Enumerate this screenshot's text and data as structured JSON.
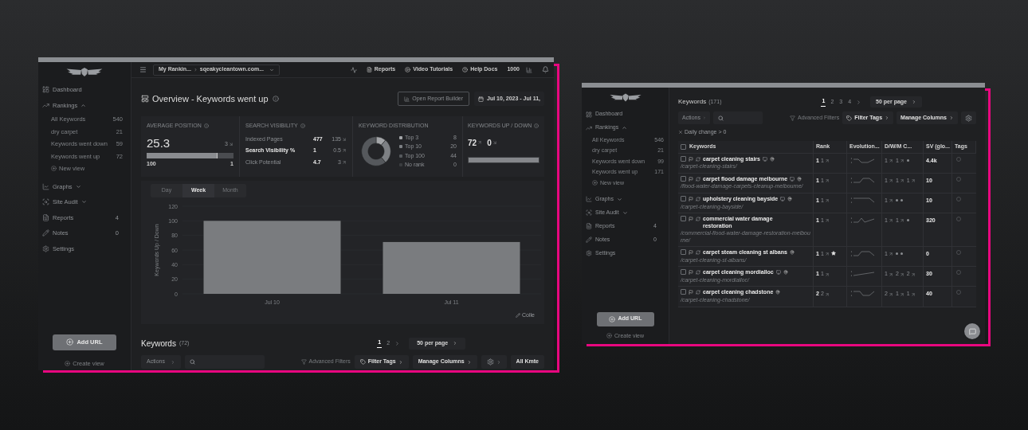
{
  "left_window": {
    "sidebar": {
      "nav": [
        {
          "label": "Dashboard"
        },
        {
          "label": "Rankings",
          "expanded": true,
          "children": [
            {
              "label": "All Keywords",
              "count": "540"
            },
            {
              "label": "dry carpet",
              "count": "21"
            },
            {
              "label": "Keywords went down",
              "count": "59"
            },
            {
              "label": "Keywords went up",
              "count": "72"
            }
          ],
          "add_label": "New view"
        },
        {
          "label": "Graphs",
          "expanded": false
        },
        {
          "label": "Site Audit",
          "expanded": false
        },
        {
          "label": "Reports",
          "count": "4"
        },
        {
          "label": "Notes",
          "count": "0"
        },
        {
          "label": "Settings"
        }
      ],
      "add_button": "Add URL",
      "create_view": "Create view"
    },
    "topbar": {
      "breadcrumb": [
        "My Rankin...",
        "sqeakycleantown.com..."
      ],
      "links": [
        "Reports",
        "Video Tutorials",
        "Help Docs"
      ],
      "credits": "1000"
    },
    "title": "Overview - Keywords went up",
    "report_button": "Open Report Builder",
    "date_range": "Jul 10, 2023 - Jul 11,",
    "average_position": {
      "title": "AVERAGE POSITION",
      "value": "25.3",
      "change": "3",
      "level": 0.82,
      "min": "100",
      "max": "1"
    },
    "search_visibility": {
      "title": "SEARCH VISIBILITY",
      "rows": [
        {
          "label": "Indexed Pages",
          "value": "477",
          "change": "135",
          "rising": false,
          "emphasis": false
        },
        {
          "label": "Search Visibility %",
          "value": "1",
          "change": "0.5",
          "rising": true,
          "emphasis": true
        },
        {
          "label": "Click Potential",
          "value": "4.7",
          "change": "3",
          "rising": true,
          "emphasis": false
        }
      ]
    },
    "keyword_distribution": {
      "title": "KEYWORD DISTRIBUTION",
      "chart_data": {
        "type": "donut",
        "categories": [
          "Top 3",
          "Top 10",
          "Top 100",
          "No rank"
        ],
        "values": [
          11.1,
          27.8,
          61.1,
          0
        ],
        "colors": [
          "#a3a5a8",
          "#7d8084",
          "#55585c",
          "#3a3c3f"
        ]
      },
      "counts": [
        "8",
        "20",
        "44",
        "0"
      ]
    },
    "keywords_up_down": {
      "title": "KEYWORDS UP / DOWN",
      "up": "72",
      "down": "0",
      "level": 1
    },
    "period_tabs": [
      {
        "label": "Day",
        "selected": false
      },
      {
        "label": "Week",
        "selected": true
      },
      {
        "label": "Month",
        "selected": false
      }
    ],
    "chart": {
      "chart_data": {
        "type": "bar",
        "ylabel": "Keywords Up / Down",
        "categories": [
          "Jul 10",
          "Jul 11"
        ],
        "values": [
          100,
          71
        ],
        "ylim": [
          0,
          120
        ],
        "yticks": [
          0,
          20,
          40,
          60,
          80,
          100,
          120
        ]
      },
      "collapse_label": "Colle"
    },
    "keywords": {
      "title": "Keywords",
      "count": "(72)",
      "pages": [
        {
          "label": "1",
          "selected": true
        },
        {
          "label": "2",
          "selected": false
        }
      ],
      "per_page": "50 per page",
      "actions": "Actions",
      "advanced_filters": "Advanced Filters",
      "filter_tags": "Filter Tags",
      "manage_columns": "Manage Columns",
      "extra_button": "All Kmte"
    }
  },
  "right_window": {
    "sidebar": {
      "nav": [
        {
          "label": "Dashboard"
        },
        {
          "label": "Rankings",
          "expanded": true,
          "children": [
            {
              "label": "All Keywords",
              "count": "546"
            },
            {
              "label": "dry carpet",
              "count": "21"
            },
            {
              "label": "Keywords went down",
              "count": "99"
            },
            {
              "label": "Keywords went up",
              "count": "171"
            }
          ],
          "add_label": "New view"
        },
        {
          "label": "Graphs",
          "expanded": false
        },
        {
          "label": "Site Audit",
          "expanded": false
        },
        {
          "label": "Reports",
          "count": "4"
        },
        {
          "label": "Notes",
          "count": "0"
        },
        {
          "label": "Settings"
        }
      ],
      "add_button": "Add URL",
      "create_view": "Create view"
    },
    "keywords": {
      "title": "Keywords",
      "count": "(171)",
      "pages": [
        {
          "label": "1",
          "selected": true
        },
        {
          "label": "2",
          "selected": false
        },
        {
          "label": "3",
          "selected": false
        },
        {
          "label": "4",
          "selected": false
        }
      ],
      "per_page": "50 per page",
      "actions": "Actions",
      "advanced_filters": "Advanced Filters",
      "filter_tags": "Filter Tags",
      "manage_columns": "Manage Columns"
    },
    "filter_chip": "Daily change > 0",
    "table": {
      "all_checked": false,
      "columns": [
        "Keywords",
        "Rank",
        "Evolution...",
        "D/W/M C...",
        "SV (glo...",
        "Tags"
      ],
      "rows": [
        {
          "checked": false,
          "keyword": "carpet cleaning stairs",
          "url": "/carpet-cleaning-stairs/",
          "device": true,
          "local": true,
          "featured": false,
          "rank": "1",
          "change": "1",
          "dwm": [
            {
              "kind": "up",
              "value": "1"
            },
            {
              "kind": "up",
              "value": "1"
            },
            {
              "kind": "none"
            }
          ],
          "sv": "4.4k"
        },
        {
          "checked": false,
          "keyword": "carpet flood damage melbourne",
          "url": "/flood-water-damage-carpets-cleanup-melbourne/",
          "device": true,
          "local": true,
          "featured": false,
          "rank": "1",
          "change": "1",
          "dwm": [
            {
              "kind": "up",
              "value": "1"
            },
            {
              "kind": "up",
              "value": "1"
            },
            {
              "kind": "up",
              "value": "1"
            }
          ],
          "sv": "10"
        },
        {
          "checked": false,
          "keyword": "upholstery cleaning bayside",
          "url": "/carpet-cleaning-bayside/",
          "device": true,
          "local": true,
          "featured": false,
          "rank": "1",
          "change": "1",
          "dwm": [
            {
              "kind": "up",
              "value": "1"
            },
            {
              "kind": "none"
            },
            {
              "kind": "none"
            }
          ],
          "sv": "10"
        },
        {
          "checked": false,
          "keyword": "commercial water damage restoration",
          "url": "/commercial-flood-water-damage-restoration-melbourne/",
          "device": false,
          "local": false,
          "featured": false,
          "rank": "1",
          "change": "1",
          "dwm": [
            {
              "kind": "up",
              "value": "1"
            },
            {
              "kind": "up",
              "value": "1"
            },
            {
              "kind": "none"
            }
          ],
          "sv": "320"
        },
        {
          "checked": false,
          "keyword": "carpet steam cleaning st albans",
          "url": "/carpet-cleaning-st-albans/",
          "device": false,
          "local": true,
          "featured": true,
          "rank": "1",
          "change": "1",
          "dwm": [
            {
              "kind": "up",
              "value": "1"
            },
            {
              "kind": "none"
            },
            {
              "kind": "none"
            }
          ],
          "sv": "0"
        },
        {
          "checked": false,
          "keyword": "carpet cleaning mordialloc",
          "url": "/carpet-cleaning-mordialloc/",
          "device": true,
          "local": true,
          "featured": false,
          "rank": "1",
          "change": "1",
          "dwm": [
            {
              "kind": "up",
              "value": "1"
            },
            {
              "kind": "up",
              "value": "2"
            },
            {
              "kind": "up",
              "value": "2"
            }
          ],
          "sv": "30"
        },
        {
          "checked": false,
          "keyword": "carpet cleaning chadstone",
          "url": "/carpet-cleaning-chadstone/",
          "device": false,
          "local": true,
          "featured": false,
          "rank": "2",
          "change": "2",
          "dwm": [
            {
              "kind": "up",
              "value": "2"
            },
            {
              "kind": "up",
              "value": "1"
            },
            {
              "kind": "up",
              "value": "1"
            }
          ],
          "sv": "40"
        }
      ]
    }
  }
}
